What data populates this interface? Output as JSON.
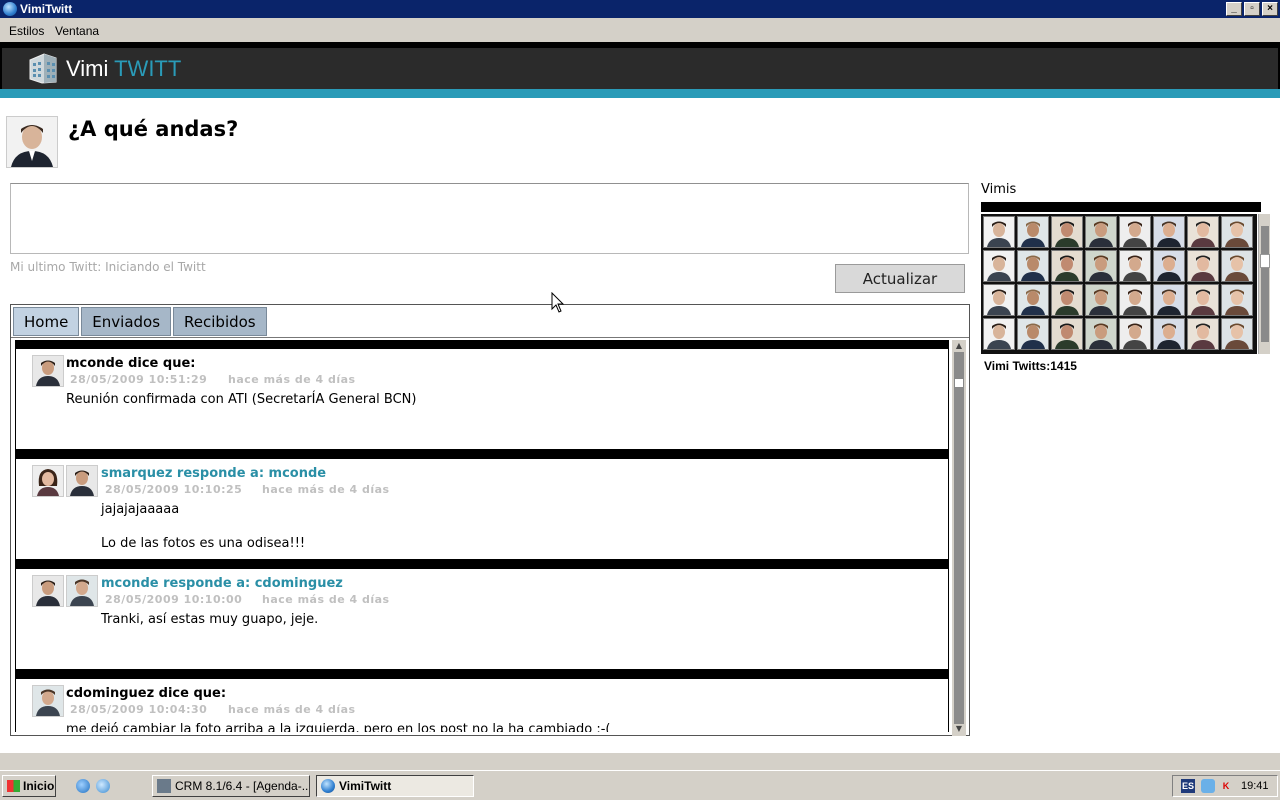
{
  "window": {
    "title": "VimiTwitt",
    "controls": {
      "minimize": "_",
      "maximize": "▫",
      "close": "×"
    }
  },
  "menu": {
    "items": [
      "Estilos",
      "Ventana"
    ]
  },
  "header": {
    "logo_main": "Vimi",
    "logo_accent": "TWITT"
  },
  "composer": {
    "question": "¿A qué andas?",
    "input_value": "",
    "last_twitt": "Mi ultimo Twitt: Iniciando el Twitt",
    "update_label": "Actualizar"
  },
  "tabs": [
    {
      "label": "Home",
      "active": true
    },
    {
      "label": "Enviados",
      "active": false
    },
    {
      "label": "Recibidos",
      "active": false
    }
  ],
  "posts": [
    {
      "head": "mconde dice que:",
      "date": "28/05/2009 10:51:29",
      "ago": "hace más de 4 días",
      "lines": [
        "Reunión confirmada con ATI (SecretarÍA General BCN)"
      ]
    },
    {
      "head": "smarquez responde a: mconde",
      "date": "28/05/2009 10:10:25",
      "ago": "hace más de 4 días",
      "lines": [
        "jajajajaaaaa",
        "Lo de las fotos es una odisea!!!"
      ]
    },
    {
      "head": "mconde responde a: cdominguez",
      "date": "28/05/2009 10:10:00",
      "ago": "hace más de 4 días",
      "lines": [
        "Tranki, así estas muy guapo, jeje."
      ]
    },
    {
      "head": "cdominguez dice que:",
      "date": "28/05/2009 10:04:30",
      "ago": "hace más de 4 días",
      "lines": [
        "me dejó cambiar la foto arriba a la izquierda, pero en los post no la ha cambiado :-("
      ]
    }
  ],
  "vimis": {
    "title": "Vimis",
    "count_label": "Vimi Twitts:1415"
  },
  "taskbar": {
    "start_label": "Inicio",
    "tasks": [
      "CRM 8.1/6.4 - [Agenda-...",
      "VimiTwitt"
    ],
    "tray_lang": "ES",
    "clock": "19:41"
  },
  "colors": {
    "accent": "#2a9bb8",
    "reply_name": "#2a8fa6",
    "tab": "#a6b7c8",
    "titlebar": "#0a246a"
  }
}
